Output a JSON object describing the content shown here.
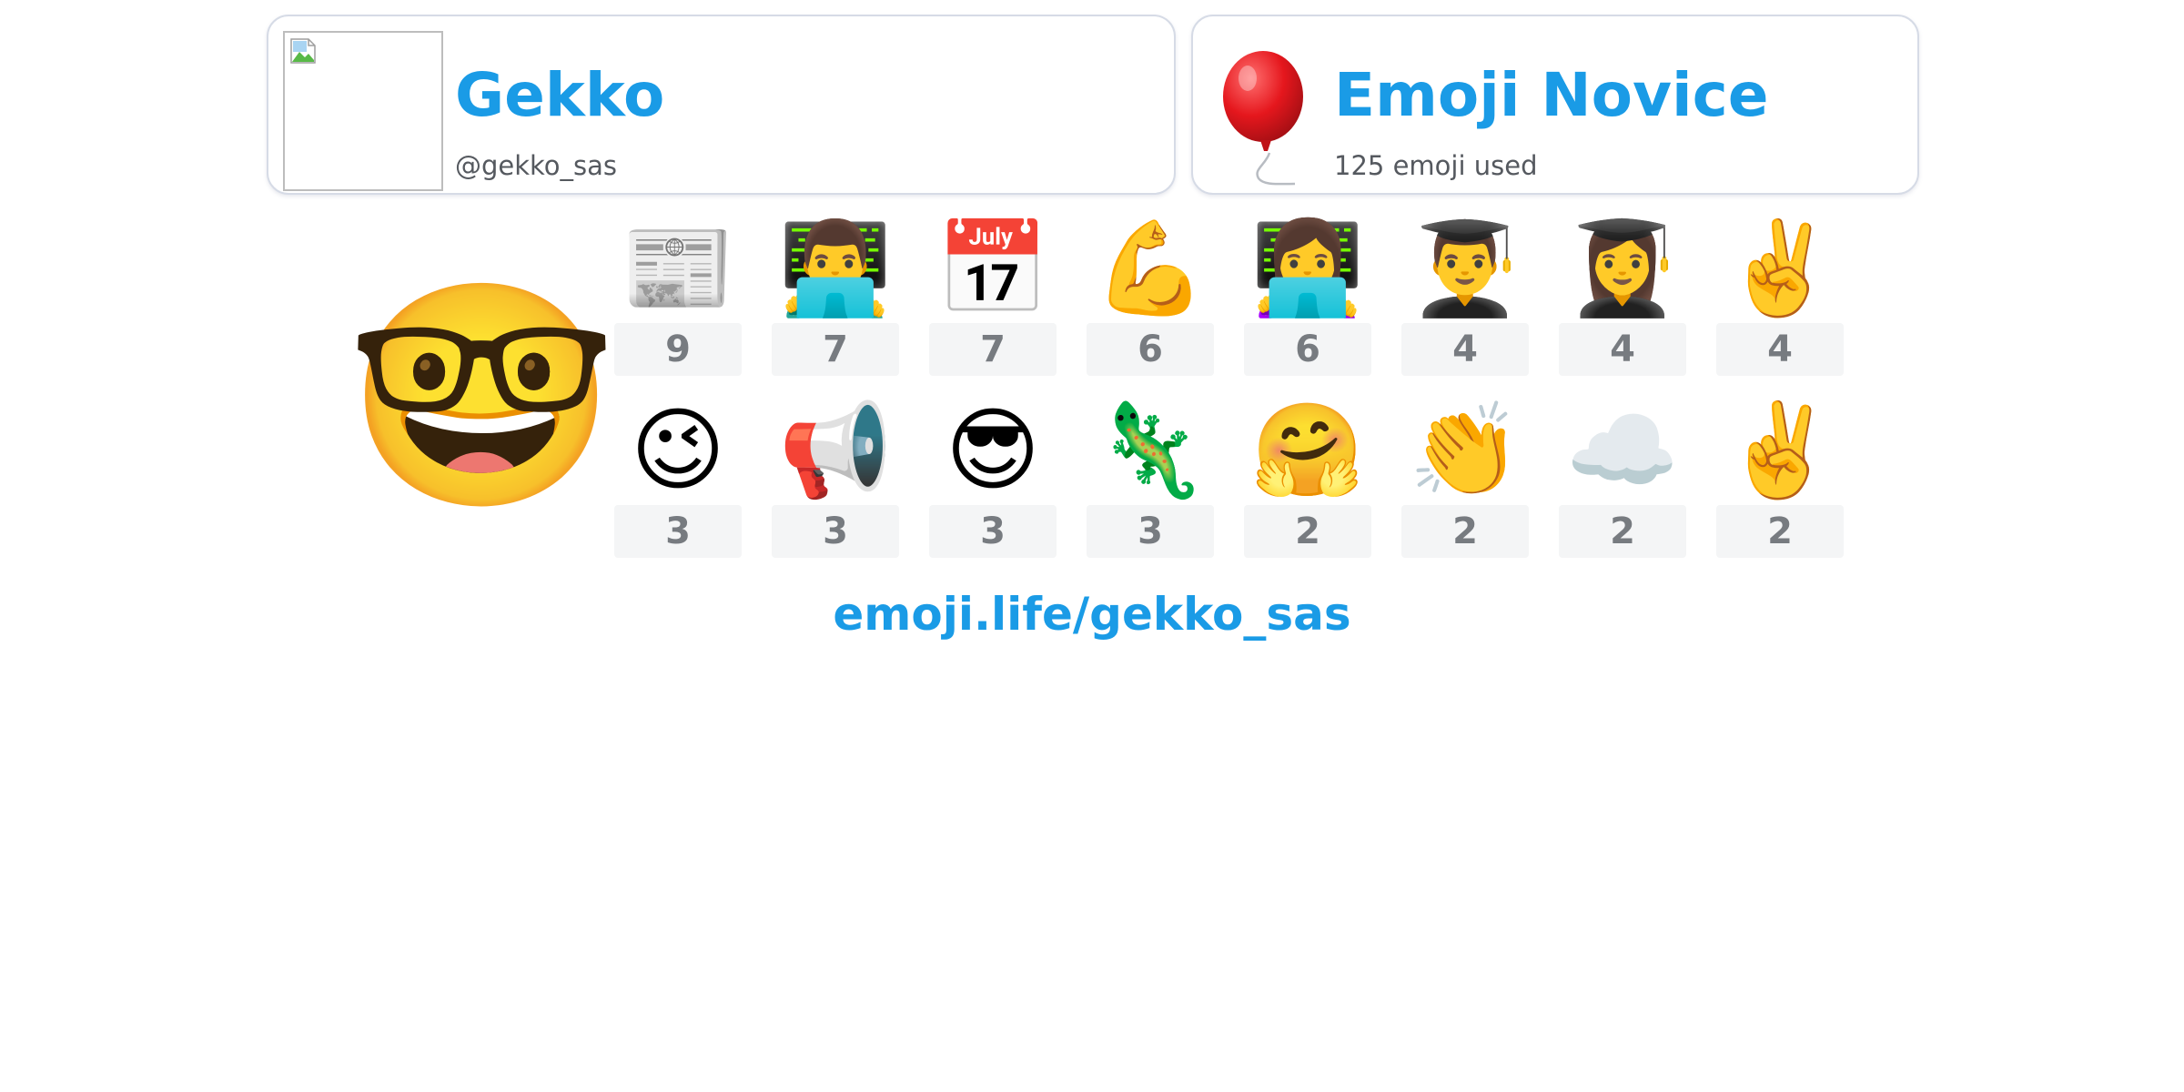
{
  "colors": {
    "accent": "#1a9be6",
    "muted_text": "#55595f",
    "count_text": "#777b80",
    "count_bg": "#f4f5f6",
    "card_border": "#d6dbe6"
  },
  "user_card": {
    "display_name": "Gekko",
    "handle": "@gekko_sas",
    "avatar_icon": "broken-image-icon"
  },
  "rank_card": {
    "rank_title": "Emoji Novice",
    "usage_text": "125 emoji used",
    "rank_icon": "balloon-icon"
  },
  "top_emoji": {
    "emoji": "🤓",
    "name": "nerd-face"
  },
  "emoji_stats": [
    {
      "emoji": "📰",
      "name": "newspaper",
      "count": "9"
    },
    {
      "emoji": "👨‍💻",
      "name": "man-technologist",
      "count": "7"
    },
    {
      "emoji": "📅",
      "name": "calendar",
      "count": "7"
    },
    {
      "emoji": "💪",
      "name": "flexed-biceps",
      "count": "6"
    },
    {
      "emoji": "👩‍💻",
      "name": "woman-technologist",
      "count": "6"
    },
    {
      "emoji": "👨‍🎓",
      "name": "man-student",
      "count": "4"
    },
    {
      "emoji": "👩‍🎓",
      "name": "woman-student",
      "count": "4"
    },
    {
      "emoji": "✌️",
      "name": "victory-hand",
      "count": "4"
    },
    {
      "emoji": "😉",
      "name": "winking-face",
      "count": "3"
    },
    {
      "emoji": "📢",
      "name": "loudspeaker",
      "count": "3"
    },
    {
      "emoji": "😎",
      "name": "smiling-face-with-sunglasses",
      "count": "3"
    },
    {
      "emoji": "🦎",
      "name": "lizard",
      "count": "3"
    },
    {
      "emoji": "🤗",
      "name": "hugging-face",
      "count": "2"
    },
    {
      "emoji": "👏",
      "name": "clapping-hands",
      "count": "2"
    },
    {
      "emoji": "☁️",
      "name": "cloud",
      "count": "2"
    },
    {
      "emoji": "✌️",
      "name": "victory-hand",
      "count": "2"
    }
  ],
  "footer": {
    "profile_link": "emoji.life/gekko_sas"
  }
}
